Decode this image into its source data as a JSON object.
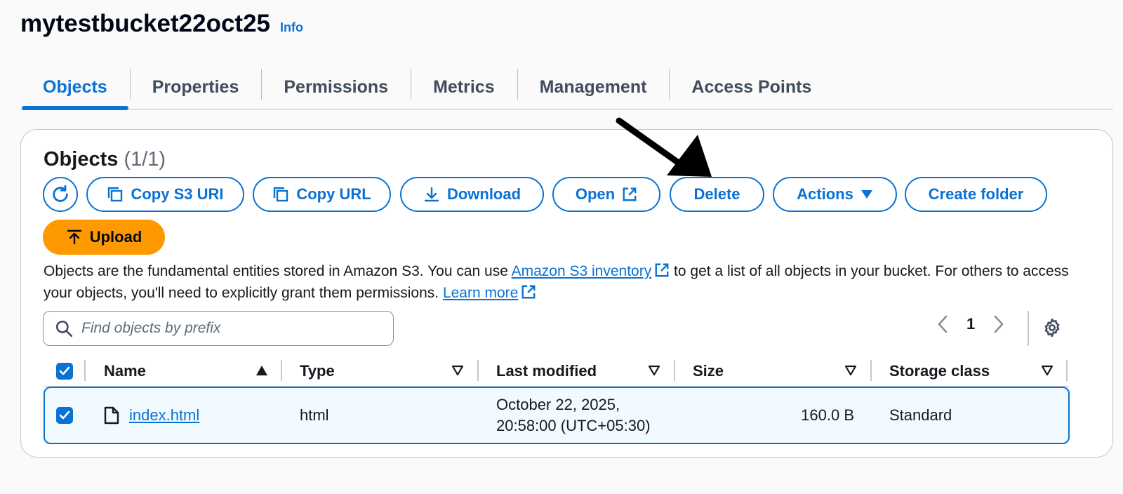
{
  "header": {
    "bucket_name": "mytestbucket22oct25",
    "info_label": "Info"
  },
  "tabs": [
    {
      "label": "Objects",
      "active": true
    },
    {
      "label": "Properties"
    },
    {
      "label": "Permissions"
    },
    {
      "label": "Metrics"
    },
    {
      "label": "Management"
    },
    {
      "label": "Access Points"
    }
  ],
  "panel": {
    "title": "Objects",
    "count": "(1/1)"
  },
  "toolbar": {
    "copy_s3_uri": "Copy S3 URI",
    "copy_url": "Copy URL",
    "download": "Download",
    "open": "Open",
    "delete": "Delete",
    "actions": "Actions",
    "create_folder": "Create folder",
    "upload": "Upload"
  },
  "description": {
    "part1": "Objects are the fundamental entities stored in Amazon S3. You can use ",
    "inventory_link": "Amazon S3 inventory",
    "part2": " to get a list of all objects in your bucket. For others to access your objects, you'll need to explicitly grant them permissions. ",
    "learn_more": "Learn more"
  },
  "search": {
    "placeholder": "Find objects by prefix",
    "value": ""
  },
  "pagination": {
    "current_page": "1"
  },
  "table": {
    "columns": [
      "Name",
      "Type",
      "Last modified",
      "Size",
      "Storage class"
    ],
    "rows": [
      {
        "name": "index.html",
        "type": "html",
        "last_modified_line1": "October 22, 2025,",
        "last_modified_line2": "20:58:00 (UTC+05:30)",
        "size": "160.0 B",
        "storage_class": "Standard",
        "selected": true
      }
    ]
  },
  "icons": {
    "refresh": "refresh-icon",
    "copy": "copy-icon",
    "download": "download-icon",
    "external": "external-link-icon",
    "caret": "caret-down-icon",
    "upload": "upload-icon",
    "search": "search-icon",
    "settings": "gear-icon",
    "file": "file-icon"
  },
  "colors": {
    "primary": "#0972d3",
    "upload": "#ff9900",
    "selected_row": "#f1faff"
  }
}
